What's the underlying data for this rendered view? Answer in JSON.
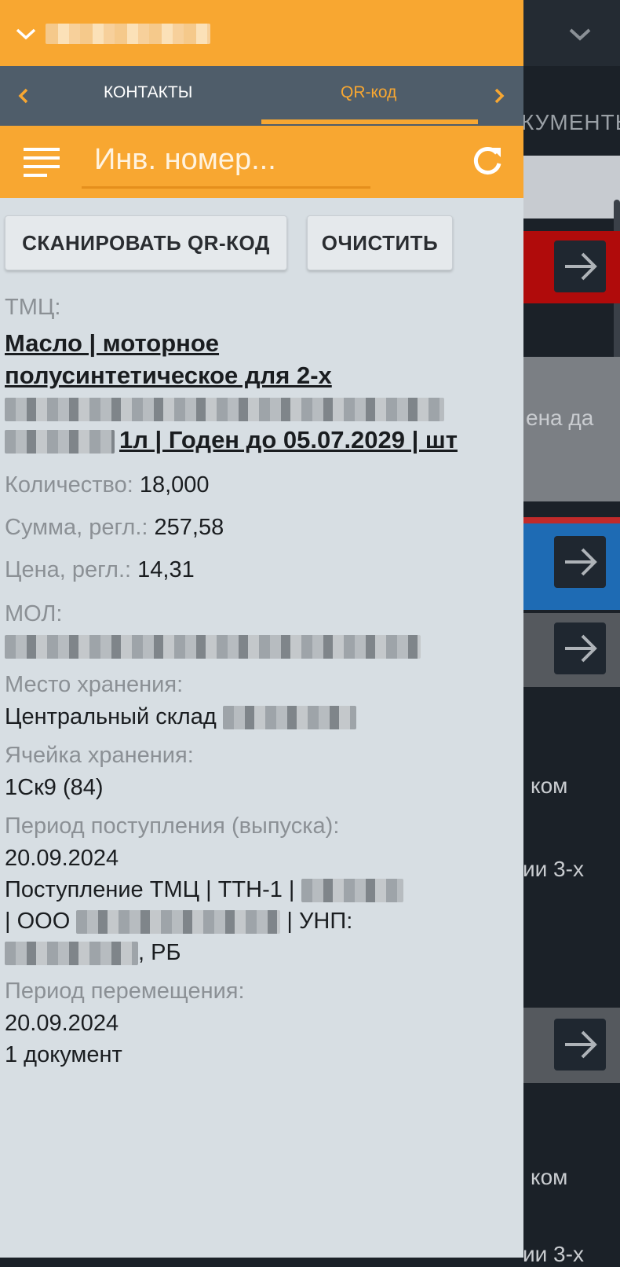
{
  "background": {
    "docs_label": "КУМЕНТЫ",
    "text_1": "ена да",
    "text_2": "ком",
    "text_3": "ии 3-х",
    "text_4": "ком",
    "text_5": "ии 3-х"
  },
  "tabs": {
    "contacts": "КОНТАКТЫ",
    "qr": "QR-код"
  },
  "search": {
    "placeholder": "Инв. номер..."
  },
  "buttons": {
    "scan": "СКАНИРОВАТЬ QR-КОД",
    "clear": "ОЧИСТИТЬ"
  },
  "item": {
    "label": "ТМЦ:",
    "title_line1": "Масло | моторное",
    "title_line2": "полусинтетическое для 2-х",
    "title_line4": "1л | Годен до 05.07.2029 | шт",
    "quantity_label": "Количество:",
    "quantity_value": "18,000",
    "sum_label": "Сумма, регл.:",
    "sum_value": "257,58",
    "price_label": "Цена, регл.:",
    "price_value": "14,31",
    "mol_label": "МОЛ:",
    "storage_label": "Место хранения:",
    "storage_value": "Центральный склад",
    "cell_label": "Ячейка хранения:",
    "cell_value": "1Ск9 (84)",
    "receipt_period_label": "Период поступления (выпуска):",
    "receipt_date": "20.09.2024",
    "receipt_doc": "Поступление ТМЦ | ТТН-1 |",
    "receipt_org_prefix": "| ООО",
    "receipt_unp": "| УНП:",
    "receipt_country": ", РБ",
    "move_period_label": "Период перемещения:",
    "move_date": "20.09.2024",
    "move_docs": "1 документ"
  }
}
